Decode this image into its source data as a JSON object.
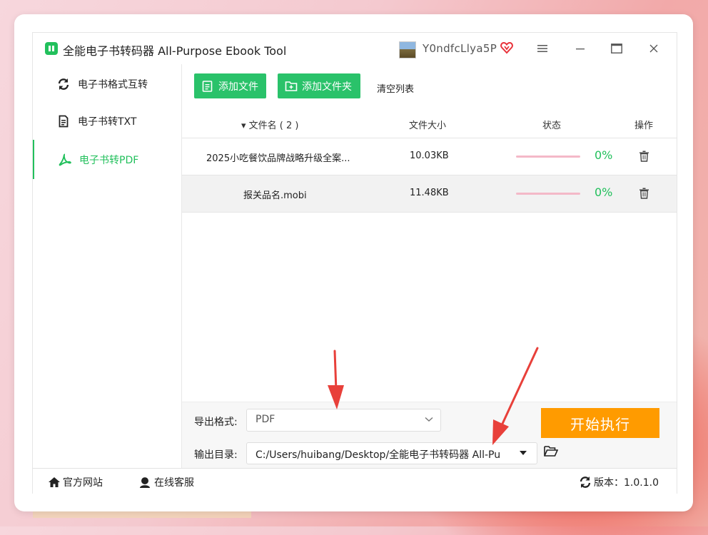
{
  "app": {
    "title": "全能电子书转码器 All-Purpose Ebook Tool",
    "username": "Y0ndfcLlya5P"
  },
  "sidebar": {
    "items": [
      {
        "label": "电子书格式互转",
        "icon": "refresh-icon",
        "active": false
      },
      {
        "label": "电子书转TXT",
        "icon": "document-icon",
        "active": false
      },
      {
        "label": "电子书转PDF",
        "icon": "pdf-icon",
        "active": true
      }
    ]
  },
  "toolbar": {
    "add_file": "添加文件",
    "add_folder": "添加文件夹",
    "clear_list": "清空列表"
  },
  "table": {
    "headers": {
      "name": "文件名 ( 2 )",
      "size": "文件大小",
      "status": "状态",
      "action": "操作"
    },
    "rows": [
      {
        "name": "2025小吃餐饮品牌战略升级全案...",
        "size": "10.03KB",
        "progress": "0%"
      },
      {
        "name": "报关品名.mobi",
        "size": "11.48KB",
        "progress": "0%"
      }
    ]
  },
  "settings": {
    "format_label": "导出格式:",
    "format_value": "PDF",
    "output_label": "输出目录:",
    "output_value": "C:/Users/huibang/Desktop/全能电子书转码器 All-Pu",
    "start_button": "开始执行"
  },
  "footer": {
    "website": "官方网站",
    "support": "在线客服",
    "version": "版本：1.0.1.0"
  },
  "colors": {
    "accent": "#22c05c",
    "start_button": "#ff9b00",
    "arrow": "#e8403a"
  }
}
